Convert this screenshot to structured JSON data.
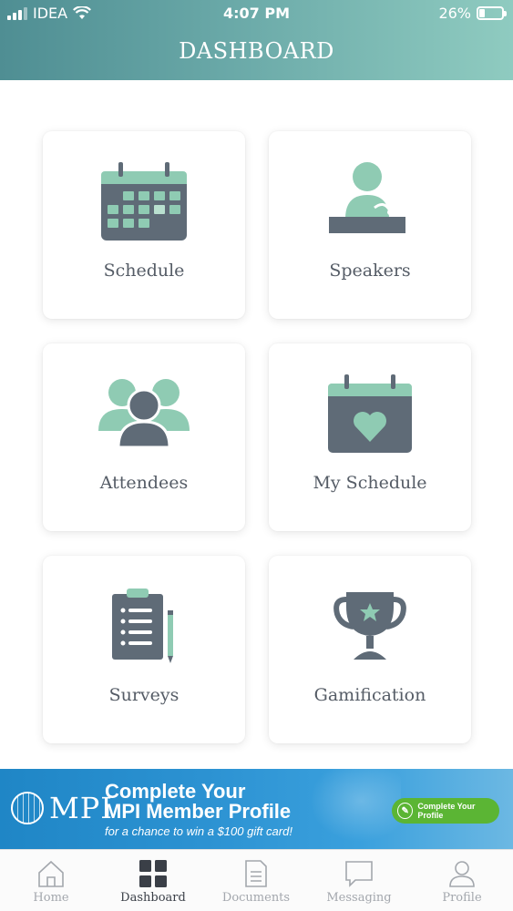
{
  "status_bar": {
    "carrier": "IDEA",
    "time": "4:07 PM",
    "battery_percent": "26%",
    "battery_level": 0.26
  },
  "header": {
    "title": "DASHBOARD"
  },
  "tiles": [
    {
      "label": "Schedule",
      "icon": "calendar-icon"
    },
    {
      "label": "Speakers",
      "icon": "speaker-podium-icon"
    },
    {
      "label": "Attendees",
      "icon": "people-group-icon"
    },
    {
      "label": "My Schedule",
      "icon": "calendar-heart-icon"
    },
    {
      "label": "Surveys",
      "icon": "clipboard-checklist-icon"
    },
    {
      "label": "Gamification",
      "icon": "trophy-icon"
    }
  ],
  "banner": {
    "logo": "MPI",
    "headline_line1": "Complete Your",
    "headline_line2": "MPI Member Profile",
    "subtext": "for a chance to win a $100 gift card!",
    "cta": "Complete Your Profile"
  },
  "tabbar": {
    "items": [
      {
        "label": "Home",
        "icon": "home-icon"
      },
      {
        "label": "Dashboard",
        "icon": "grid-icon",
        "active": true
      },
      {
        "label": "Documents",
        "icon": "document-icon"
      },
      {
        "label": "Messaging",
        "icon": "chat-bubble-icon"
      },
      {
        "label": "Profile",
        "icon": "user-icon"
      }
    ]
  },
  "colors": {
    "header_start": "#4f8e93",
    "header_end": "#8fcbc0",
    "icon_dark": "#5f6b77",
    "icon_mint": "#8fcbb3",
    "label_text": "#555c66",
    "tab_active": "#3a3f47",
    "tab_inactive": "#a3a7ad"
  }
}
